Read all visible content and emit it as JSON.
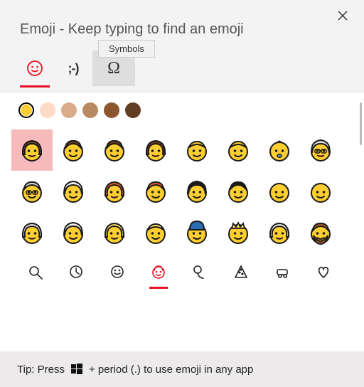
{
  "title": "Emoji - Keep typing to find an emoji",
  "closeIcon": "close",
  "tooltip": "Symbols",
  "tabs": {
    "emoji": {
      "label": "Emoji",
      "active": true
    },
    "kaomoji": {
      "label": ";-)",
      "active": false
    },
    "symbols": {
      "label": "Ω",
      "active": false
    }
  },
  "skinTones": [
    {
      "color": "#ffcf32",
      "selected": true
    },
    {
      "color": "#fedac7",
      "selected": false
    },
    {
      "color": "#d9ab8a",
      "selected": false
    },
    {
      "color": "#b88a62",
      "selected": false
    },
    {
      "color": "#8c562f",
      "selected": false
    },
    {
      "color": "#613d24",
      "selected": false
    }
  ],
  "emojis": [
    {
      "name": "woman",
      "face": "#ffcf32",
      "hair": "#6b3b1f",
      "style": "woman",
      "selected": true
    },
    {
      "name": "man",
      "face": "#ffcf32",
      "hair": "#6b3b1f",
      "style": "man"
    },
    {
      "name": "boy",
      "face": "#ffcf32",
      "hair": "#6b3b1f",
      "style": "boy"
    },
    {
      "name": "girl",
      "face": "#ffcf32",
      "hair": "#6b3b1f",
      "style": "girl"
    },
    {
      "name": "person",
      "face": "#ffcf32",
      "hair": "#ffcf32",
      "style": "person"
    },
    {
      "name": "child",
      "face": "#ffcf32",
      "hair": "#ffcf32",
      "style": "child"
    },
    {
      "name": "baby",
      "face": "#ffcf32",
      "hair": "#ffcf32",
      "style": "baby"
    },
    {
      "name": "older-woman",
      "face": "#ffcf32",
      "hair": "#dcdcdc",
      "style": "oldwoman"
    },
    {
      "name": "older-man",
      "face": "#ffcf32",
      "hair": "#dcdcdc",
      "style": "oldman"
    },
    {
      "name": "white-hair-person",
      "face": "#ffcf32",
      "hair": "#f0f0f0",
      "style": "curly"
    },
    {
      "name": "red-hair-woman",
      "face": "#ffcf32",
      "hair": "#e75a2b",
      "style": "woman"
    },
    {
      "name": "red-hair-man",
      "face": "#ffcf32",
      "hair": "#e75a2b",
      "style": "man"
    },
    {
      "name": "dark-hair-woman",
      "face": "#ffcf32",
      "hair": "#1a1a1a",
      "style": "curly"
    },
    {
      "name": "dark-hair-man",
      "face": "#ffcf32",
      "hair": "#1a1a1a",
      "style": "man"
    },
    {
      "name": "bald-person",
      "face": "#ffcf32",
      "hair": "#ffcf32",
      "style": "bald"
    },
    {
      "name": "bald-man",
      "face": "#ffcf32",
      "hair": "#ffcf32",
      "style": "bald"
    },
    {
      "name": "white-hair-woman",
      "face": "#ffcf32",
      "hair": "#f0f0f0",
      "style": "woman"
    },
    {
      "name": "white-hair-person2",
      "face": "#ffcf32",
      "hair": "#f0f0f0",
      "style": "curly"
    },
    {
      "name": "blond-woman",
      "face": "#ffcf32",
      "hair": "#ffe06a",
      "style": "woman"
    },
    {
      "name": "blond-person",
      "face": "#ffcf32",
      "hair": "#ffe06a",
      "style": "person"
    },
    {
      "name": "guard",
      "face": "#ffcf32",
      "hair": "#2d6db3",
      "style": "hat"
    },
    {
      "name": "royal",
      "face": "#ffcf32",
      "hair": "#ffe06a",
      "style": "crown"
    },
    {
      "name": "woman-veil",
      "face": "#ffcf32",
      "hair": "#f0f0f0",
      "style": "veil"
    },
    {
      "name": "bearded-person",
      "face": "#ffcf32",
      "hair": "#b05a2a",
      "style": "beard"
    }
  ],
  "categories": [
    {
      "name": "search",
      "active": false
    },
    {
      "name": "recent",
      "active": false
    },
    {
      "name": "smileys",
      "active": false
    },
    {
      "name": "people",
      "active": true
    },
    {
      "name": "celebration",
      "active": false
    },
    {
      "name": "food",
      "active": false
    },
    {
      "name": "transport",
      "active": false
    },
    {
      "name": "hearts",
      "active": false
    }
  ],
  "tip": {
    "prefix": "Tip: Press ",
    "suffix": " + period (.) to use emoji in any app"
  }
}
